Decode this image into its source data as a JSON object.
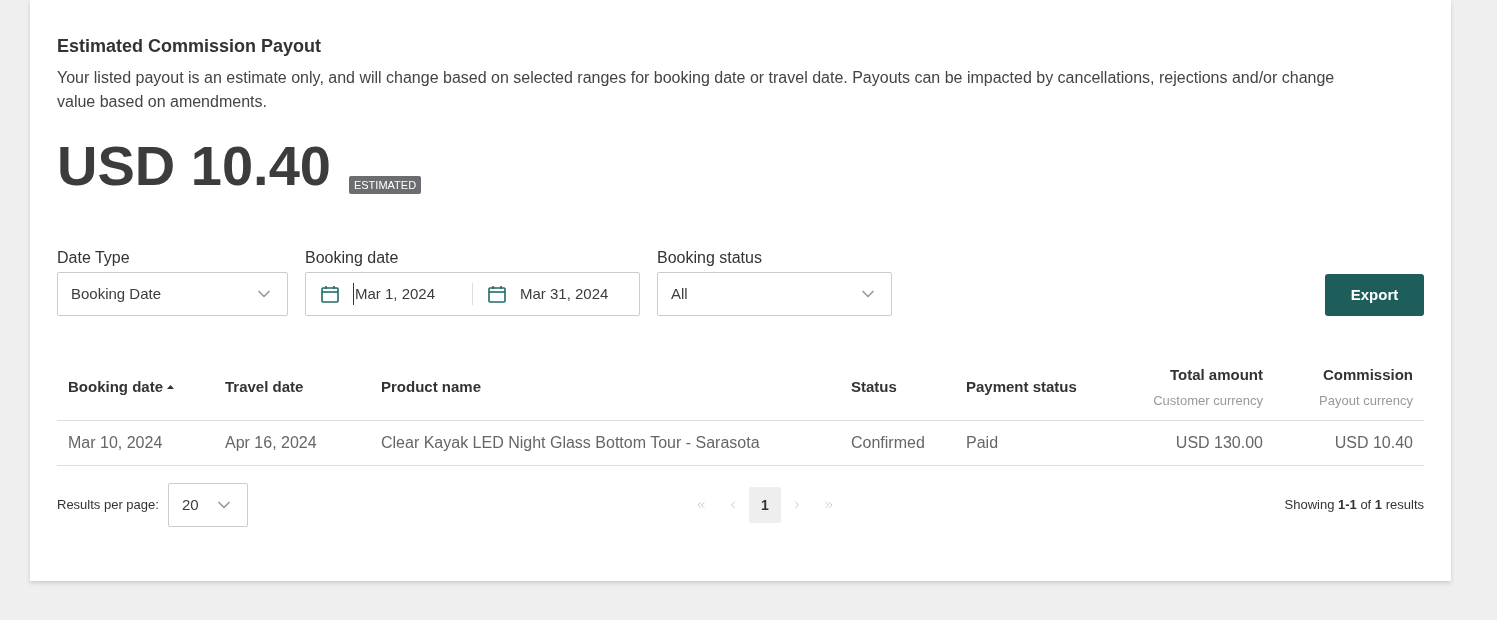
{
  "payout": {
    "title": "Estimated Commission Payout",
    "description": "Your listed payout is an estimate only, and will change based on selected ranges for booking date or travel date. Payouts can be impacted by cancellations, rejections and/or change value based on amendments.",
    "amount": "USD 10.40",
    "badge": "ESTIMATED"
  },
  "filters": {
    "date_type": {
      "label": "Date Type",
      "value": "Booking Date"
    },
    "booking_date": {
      "label": "Booking date",
      "start": "Mar 1, 2024",
      "end": "Mar 31, 2024"
    },
    "booking_status": {
      "label": "Booking status",
      "value": "All"
    },
    "export_button": "Export"
  },
  "table": {
    "columns": [
      {
        "label": "Booking date",
        "sorted": true
      },
      {
        "label": "Travel date",
        "sorted": false
      },
      {
        "label": "Product name",
        "sorted": false
      },
      {
        "label": "Status",
        "sorted": false
      },
      {
        "label": "Payment status",
        "sorted": false
      },
      {
        "label": "Total amount",
        "subtitle": "Customer currency",
        "sorted": false
      },
      {
        "label": "Commission",
        "subtitle": "Payout currency",
        "sorted": false
      }
    ],
    "rows": [
      [
        "Mar 10, 2024",
        "Apr 16, 2024",
        "Clear Kayak LED Night Glass Bottom Tour - Sarasota",
        "Confirmed",
        "Paid",
        "USD 130.00",
        "USD 10.40"
      ]
    ]
  },
  "footer": {
    "per_page_label": "Results per page:",
    "per_page": "20",
    "pages": [
      {
        "label": "1",
        "selected": true
      }
    ],
    "first_disabled": true,
    "prev_disabled": true,
    "next_disabled": true,
    "last_disabled": true,
    "showing": "Showing **1-1** of **1** results"
  }
}
